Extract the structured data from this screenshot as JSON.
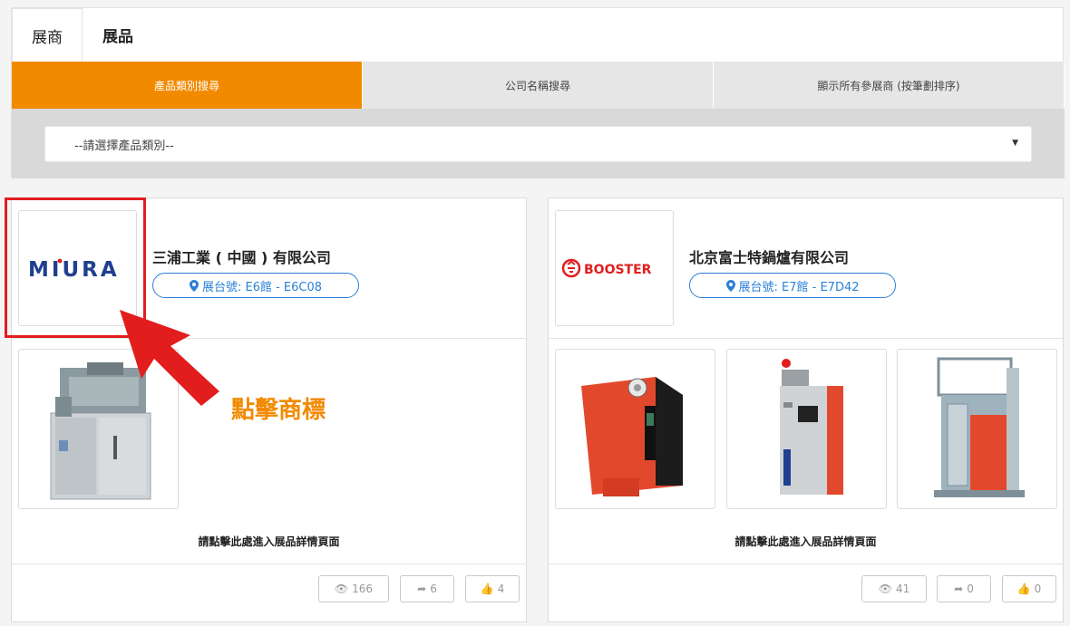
{
  "tabs": {
    "exhibitors": "展商",
    "products": "展品"
  },
  "subtabs": {
    "category": "產品類別搜尋",
    "company": "公司名稱搜尋",
    "all": "顯示所有參展商 (按筆劃排序)"
  },
  "filter": {
    "placeholder": "--請選擇產品類別--",
    "caret": "▼"
  },
  "cards": [
    {
      "logo_text": "MIURA",
      "company": "三浦工業 ( 中國 ) 有限公司",
      "booth": "展台號: E6館 - E6C08",
      "detail": "請點擊此處進入展品詳情頁面",
      "views": "166",
      "shares": "6",
      "likes": "4"
    },
    {
      "logo_text": "BOOSTER",
      "company": "北京富士特鍋爐有限公司",
      "booth": "展台號: E7館 - E7D42",
      "detail": "請點擊此處進入展品詳情頁面",
      "views": "41",
      "shares": "0",
      "likes": "0"
    }
  ],
  "annotation": {
    "label": "點擊商標"
  },
  "colors": {
    "accent": "#f28a00",
    "link": "#2b7fd6",
    "highlight": "#e21d1d"
  }
}
